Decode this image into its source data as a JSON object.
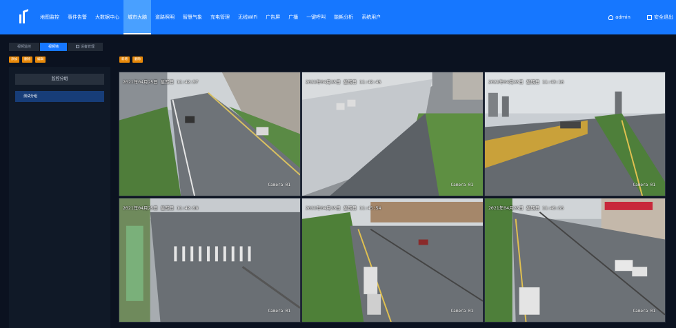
{
  "nav": {
    "items": [
      "地图监控",
      "事件告警",
      "大数据中心",
      "城市大脑",
      "道路照明",
      "智慧气象",
      "充电管理",
      "无线WiFi",
      "广告屏",
      "广播",
      "一键呼叫",
      "能耗分析",
      "系统用户"
    ],
    "active_index": 3,
    "user": "admin",
    "logout": "安全退出"
  },
  "tabs": [
    "视频监控",
    "视频墙",
    "设备管理"
  ],
  "active_tab": 1,
  "left_buttons": [
    "添加",
    "删除",
    "编辑"
  ],
  "right_buttons": [
    "新增",
    "删除"
  ],
  "sidebar": {
    "title": "监控分组",
    "items": [
      "测试分组"
    ]
  },
  "cameras": [
    {
      "timestamp": "2021年04月25日 星期日 11:42:57",
      "label": "Camera 01"
    },
    {
      "timestamp": "2021年04月25日 星期日 11:42:46",
      "label": "Camera 01"
    },
    {
      "timestamp": "2021年04月25日 星期日 11:43:16",
      "label": "Camera 01"
    },
    {
      "timestamp": "2021年04月25日 星期日 11:42:58",
      "label": "Camera 01"
    },
    {
      "timestamp": "2021年04月25日 星期日 11:45:54",
      "label": "Camera 01"
    },
    {
      "timestamp": "2021年04月25日 星期日 11:45:55",
      "label": "Camera 01"
    }
  ],
  "colors": {
    "brand": "#1677ff",
    "accent_button": "#e8890a",
    "background": "#0b1220",
    "panel": "#101927",
    "selected_item": "#173d78"
  }
}
